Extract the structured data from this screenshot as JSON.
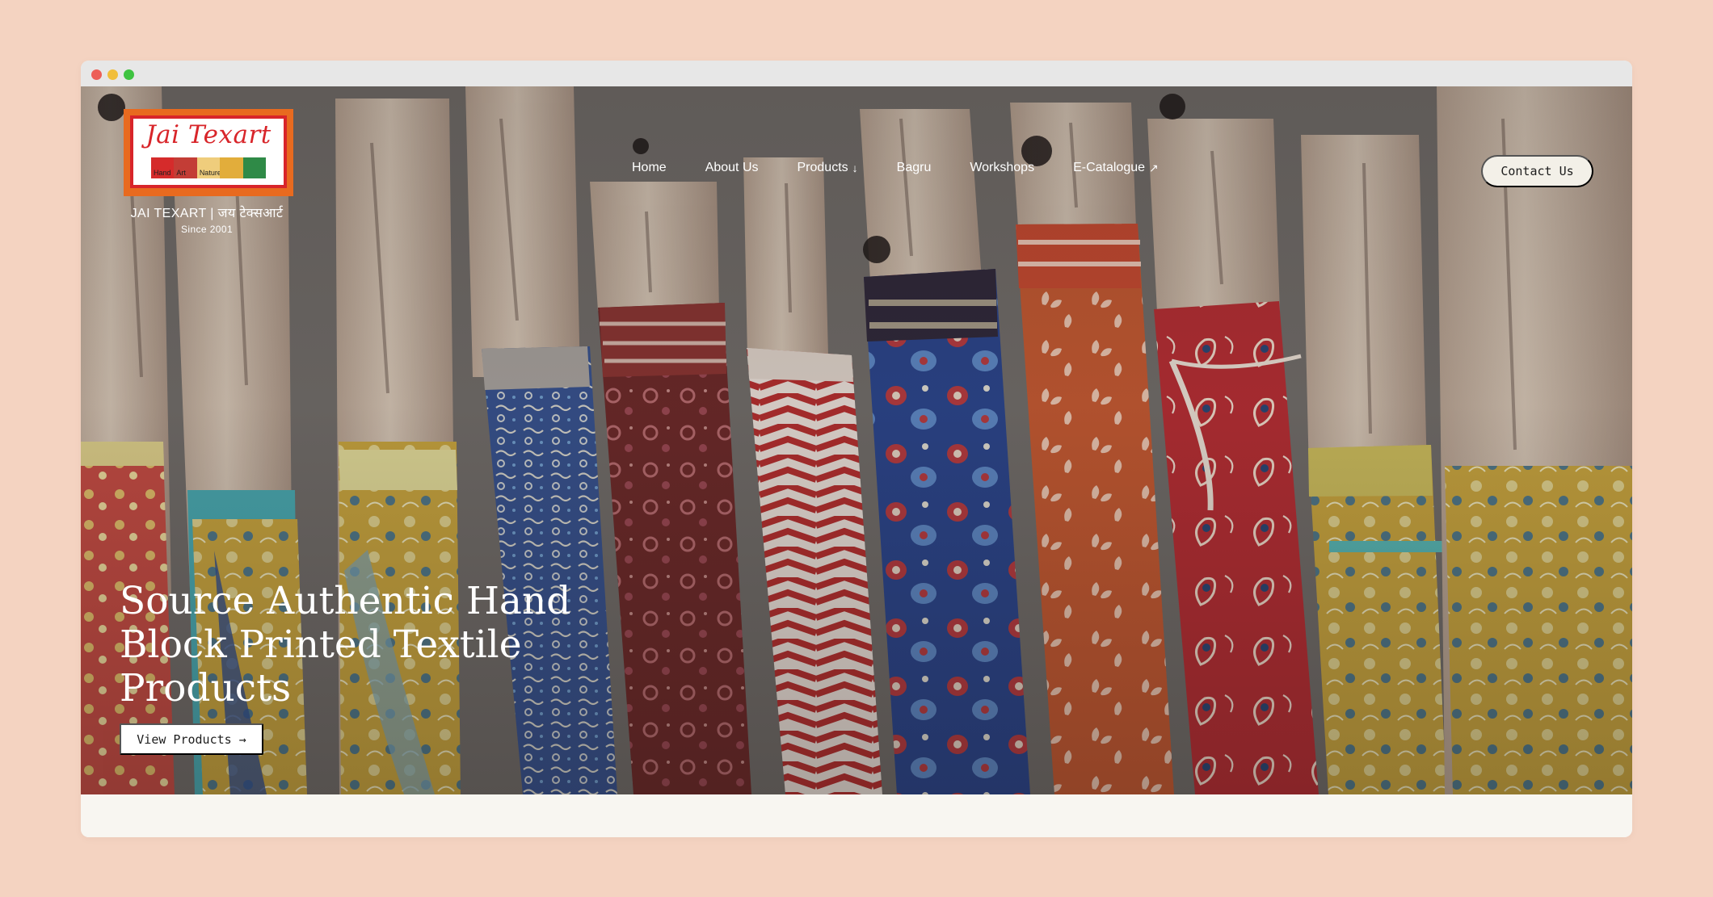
{
  "brand": {
    "logo_script": "Jai Texart",
    "strip_labels": [
      "Hand",
      "Art",
      "Nature"
    ],
    "title": "JAI TEXART | जय टेक्सआर्ट",
    "since": "Since 2001"
  },
  "nav": {
    "items": [
      {
        "label": "Home"
      },
      {
        "label": "About Us"
      },
      {
        "label": "Products",
        "icon": "↓"
      },
      {
        "label": "Bagru"
      },
      {
        "label": "Workshops"
      },
      {
        "label": "E-Catalogue",
        "icon": "↗"
      }
    ],
    "contact_label": "Contact Us"
  },
  "hero": {
    "heading": "Source Authentic Hand Block Printed Textile Products",
    "cta_label": "View Products →"
  },
  "colors": {
    "page_bg": "#f4d3c1",
    "logo_orange": "#e86a1f",
    "logo_red": "#d8252a",
    "contact_bg": "#f3f0e8"
  }
}
